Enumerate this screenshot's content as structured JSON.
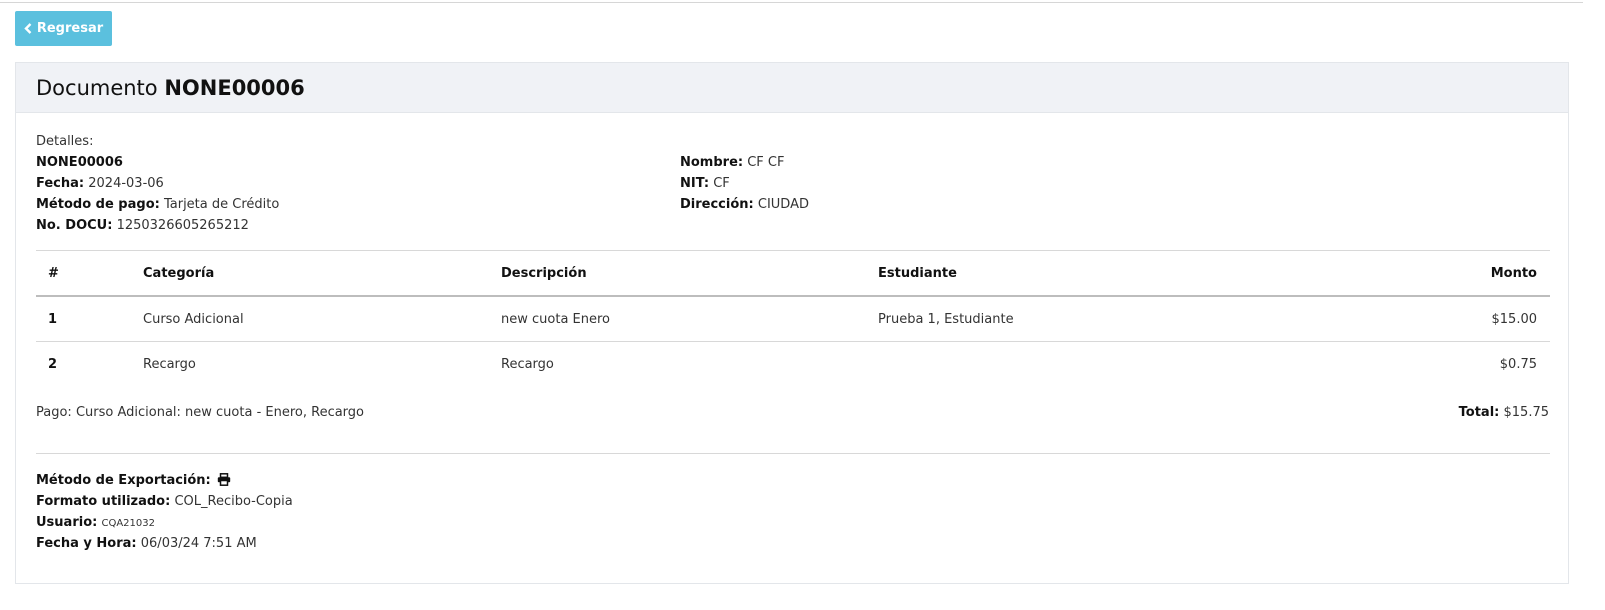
{
  "nav": {
    "back_label": "Regresar"
  },
  "document": {
    "title_prefix": "Documento",
    "title_code": "NONE00006"
  },
  "details": {
    "heading": "Detalles:",
    "code": "NONE00006",
    "fecha_label": "Fecha:",
    "fecha_value": "2024-03-06",
    "metodo_pago_label": "Método de pago:",
    "metodo_pago_value": "Tarjeta de Crédito",
    "no_docu_label": "No. DOCU:",
    "no_docu_value": "1250326605265212",
    "nombre_label": "Nombre:",
    "nombre_value": "CF CF",
    "nit_label": "NIT:",
    "nit_value": "CF",
    "direccion_label": "Dirección:",
    "direccion_value": "CIUDAD"
  },
  "table": {
    "headers": [
      "#",
      "Categoría",
      "Descripción",
      "Estudiante",
      "Monto"
    ],
    "rows": [
      {
        "num": "1",
        "categoria": "Curso Adicional",
        "descripcion": "new cuota Enero",
        "estudiante": "Prueba 1, Estudiante",
        "monto": "$15.00"
      },
      {
        "num": "2",
        "categoria": "Recargo",
        "descripcion": "Recargo",
        "estudiante": "",
        "monto": "$0.75"
      }
    ]
  },
  "summary": {
    "pago_text": "Pago: Curso Adicional: new cuota - Enero, Recargo",
    "total_label": "Total:",
    "total_value": "$15.75"
  },
  "export": {
    "metodo_label": "Método de Exportación:",
    "metodo_icon": "print-icon",
    "formato_label": "Formato utilizado:",
    "formato_value": "COL_Recibo-Copia",
    "usuario_label": "Usuario:",
    "usuario_value": "CQA21032",
    "fecha_hora_label": "Fecha y Hora:",
    "fecha_hora_value": "06/03/24 7:51 AM"
  },
  "colors": {
    "back_button": "#5bc0de",
    "header_bg": "#f0f2f6"
  }
}
